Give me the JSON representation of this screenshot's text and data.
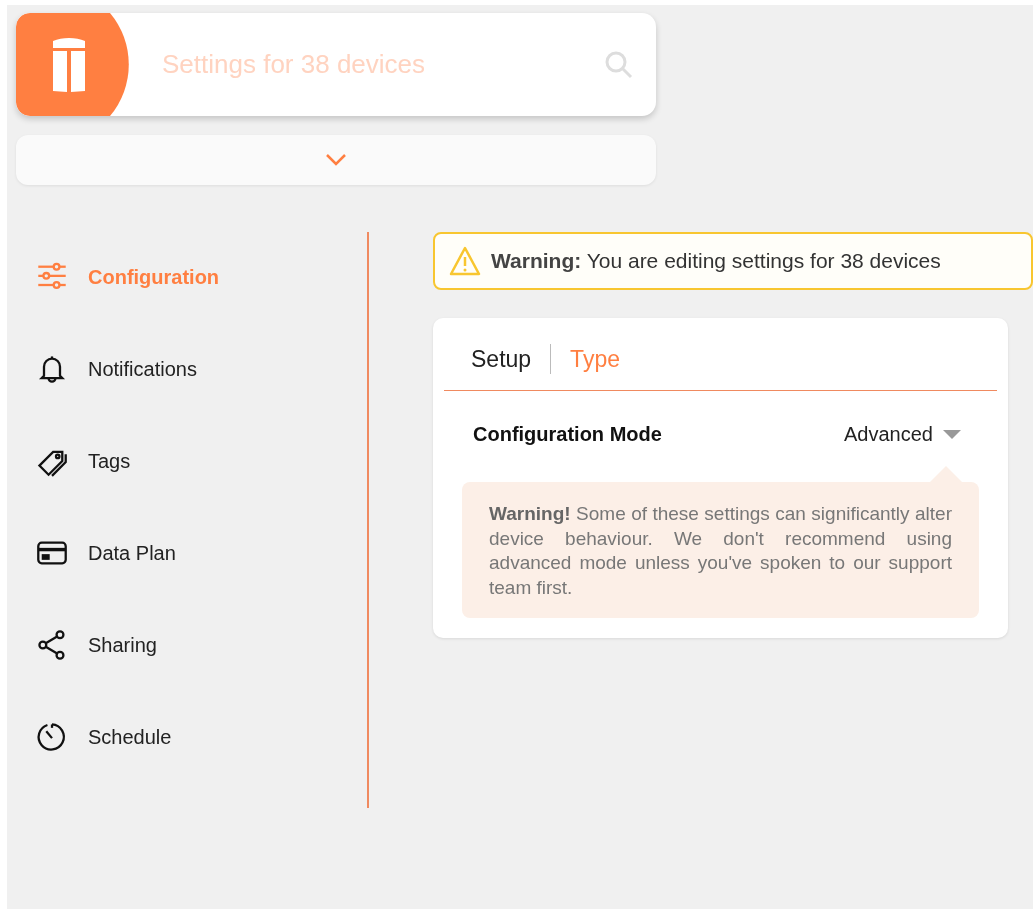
{
  "header": {
    "search": {
      "placeholder": "Settings for 38 devices"
    }
  },
  "sidebar": {
    "items": [
      {
        "label": "Configuration",
        "selected": true
      },
      {
        "label": "Notifications",
        "selected": false
      },
      {
        "label": "Tags",
        "selected": false
      },
      {
        "label": "Data Plan",
        "selected": false
      },
      {
        "label": "Sharing",
        "selected": false
      },
      {
        "label": "Schedule",
        "selected": false
      }
    ]
  },
  "banner": {
    "text": "**Warning:** You are editing settings for 38 devices"
  },
  "tabs": [
    {
      "label": "Setup",
      "selected": false
    },
    {
      "label": "Type",
      "selected": true
    }
  ],
  "setting": {
    "label": "Configuration Mode",
    "value": "Advanced"
  },
  "tooltip": {
    "text": "**Warning!** Some of these settings can significantly alter device behaviour. We don't recommend using advanced mode unless you've spoken to our support team first."
  }
}
